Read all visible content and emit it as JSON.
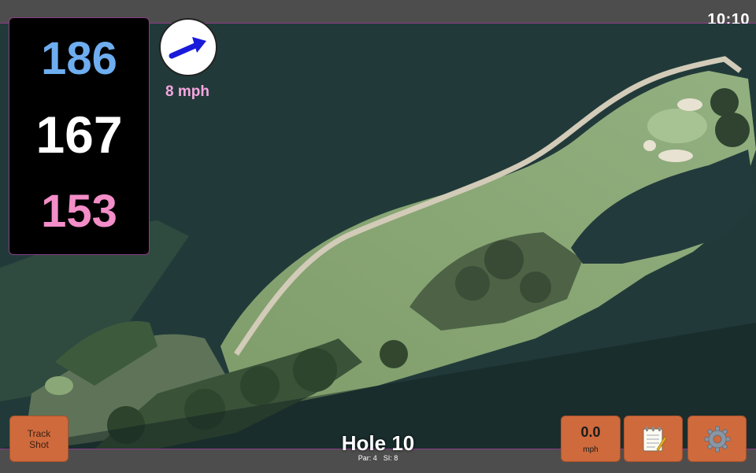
{
  "status_bar": {
    "time": "10:10"
  },
  "distances": {
    "back": "186",
    "middle": "167",
    "front": "153"
  },
  "wind": {
    "speed": "8 mph",
    "arrow_icon": "arrow-right-up-icon"
  },
  "hole": {
    "title": "Hole 10",
    "par": "Par: 4",
    "stroke_index": "SI: 8"
  },
  "buttons": {
    "track_shot_line1": "Track",
    "track_shot_line2": "Shot",
    "speed_value": "0.0",
    "speed_unit": "mph",
    "notes_icon": "notepad-icon",
    "settings_icon": "gear-icon"
  },
  "colors": {
    "back_distance": "#6eaef0",
    "middle_distance": "#ffffff",
    "front_distance": "#f38ec8",
    "wind_text": "#f5a6e0",
    "button": "#cf6a3c",
    "accent_line": "#8c3b87"
  }
}
